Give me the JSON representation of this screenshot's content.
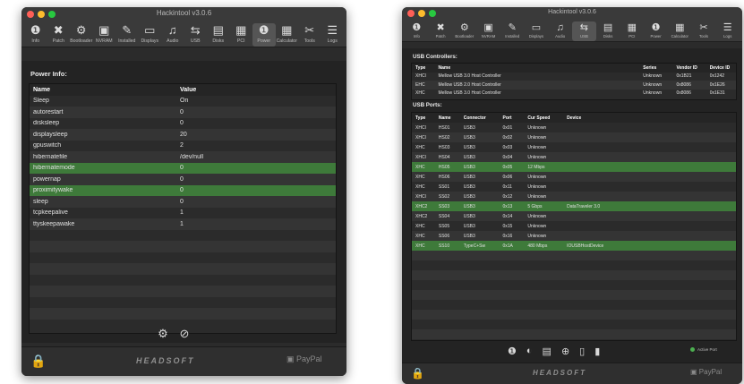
{
  "window1": {
    "title": "Hackintool v3.0.6",
    "toolbar": [
      {
        "icon": "info-icon",
        "glyph": "❶",
        "label": "Info"
      },
      {
        "icon": "patch-icon",
        "glyph": "✖",
        "label": "Patch"
      },
      {
        "icon": "bootloader-icon",
        "glyph": "⚙",
        "label": "Bootloader"
      },
      {
        "icon": "nvram-icon",
        "glyph": "▣",
        "label": "NVRAM"
      },
      {
        "icon": "installed-icon",
        "glyph": "✎",
        "label": "Installed"
      },
      {
        "icon": "displays-icon",
        "glyph": "▭",
        "label": "Displays"
      },
      {
        "icon": "audio-icon",
        "glyph": "♫",
        "label": "Audio"
      },
      {
        "icon": "usb-icon",
        "glyph": "⇆",
        "label": "USB"
      },
      {
        "icon": "disks-icon",
        "glyph": "▤",
        "label": "Disks"
      },
      {
        "icon": "pci-icon",
        "glyph": "▦",
        "label": "PCI"
      },
      {
        "icon": "power-icon",
        "glyph": "❶",
        "label": "Power"
      },
      {
        "icon": "calculator-icon",
        "glyph": "▦",
        "label": "Calculator"
      },
      {
        "icon": "tools-icon",
        "glyph": "✂",
        "label": "Tools"
      },
      {
        "icon": "logs-icon",
        "glyph": "☰",
        "label": "Logs"
      }
    ],
    "active_tab": "Power",
    "section": "Power Info:",
    "columns": [
      "Name",
      "Value"
    ],
    "rows": [
      {
        "name": "Sleep",
        "value": "On",
        "selected": false
      },
      {
        "name": "autorestart",
        "value": "0",
        "selected": false
      },
      {
        "name": "disksleep",
        "value": "0",
        "selected": false
      },
      {
        "name": "displaysleep",
        "value": "20",
        "selected": false
      },
      {
        "name": "gpuswitch",
        "value": "2",
        "selected": false
      },
      {
        "name": "hibernatefile",
        "value": "/dev/null",
        "selected": false
      },
      {
        "name": "hibernatemode",
        "value": "0",
        "selected": true
      },
      {
        "name": "powernap",
        "value": "0",
        "selected": false
      },
      {
        "name": "proximitywake",
        "value": "0",
        "selected": true
      },
      {
        "name": "sleep",
        "value": "0",
        "selected": false
      },
      {
        "name": "tcpkeepalive",
        "value": "1",
        "selected": false
      },
      {
        "name": "ttyskeepawake",
        "value": "1",
        "selected": false
      }
    ],
    "empty_rows": 8,
    "logo": "HEADSOFT",
    "paypal": "PayPal"
  },
  "window2": {
    "title": "Hackintool v3.0.6",
    "toolbar": [
      {
        "icon": "info-icon",
        "glyph": "❶",
        "label": "Info"
      },
      {
        "icon": "patch-icon",
        "glyph": "✖",
        "label": "Patch"
      },
      {
        "icon": "bootloader-icon",
        "glyph": "⚙",
        "label": "Bootloader"
      },
      {
        "icon": "nvram-icon",
        "glyph": "▣",
        "label": "NVRAM"
      },
      {
        "icon": "installed-icon",
        "glyph": "✎",
        "label": "Installed"
      },
      {
        "icon": "displays-icon",
        "glyph": "▭",
        "label": "Displays"
      },
      {
        "icon": "audio-icon",
        "glyph": "♫",
        "label": "Audio"
      },
      {
        "icon": "usb-icon",
        "glyph": "⇆",
        "label": "USB"
      },
      {
        "icon": "disks-icon",
        "glyph": "▤",
        "label": "Disks"
      },
      {
        "icon": "pci-icon",
        "glyph": "▦",
        "label": "PCI"
      },
      {
        "icon": "power-icon",
        "glyph": "❶",
        "label": "Power"
      },
      {
        "icon": "calculator-icon",
        "glyph": "▦",
        "label": "Calculator"
      },
      {
        "icon": "tools-icon",
        "glyph": "✂",
        "label": "Tools"
      },
      {
        "icon": "logs-icon",
        "glyph": "☰",
        "label": "Logs"
      }
    ],
    "active_tab": "USB",
    "controllers_section": "USB Controllers:",
    "controller_columns": [
      "Type",
      "Name",
      "Series",
      "Vendor ID",
      "Device ID"
    ],
    "controllers": [
      {
        "type": "XHCI",
        "name": "Mellow USB 3.0 Host Controller",
        "series": "Unknown",
        "vendor": "0x1B21",
        "device": "0x1242"
      },
      {
        "type": "EHC",
        "name": "Mellow USB 2.0 Host Controller",
        "series": "Unknown",
        "vendor": "0x8086",
        "device": "0x1E26"
      },
      {
        "type": "XHC",
        "name": "Mellow USB 3.0 Host Controller",
        "series": "Unknown",
        "vendor": "0x8086",
        "device": "0x1E31"
      }
    ],
    "ports_section": "USB Ports:",
    "port_columns": [
      "Type",
      "Name",
      "Connector",
      "Port",
      "Cur Speed",
      "Device"
    ],
    "ports": [
      {
        "type": "XHCI",
        "name": "HS01",
        "connector": "USB3",
        "port": "0x01",
        "speed": "Unknown",
        "device": "",
        "selected": false
      },
      {
        "type": "XHCI",
        "name": "HS02",
        "connector": "USB3",
        "port": "0x02",
        "speed": "Unknown",
        "device": "",
        "selected": false
      },
      {
        "type": "XHC",
        "name": "HS03",
        "connector": "USB3",
        "port": "0x03",
        "speed": "Unknown",
        "device": "",
        "selected": false
      },
      {
        "type": "XHCI",
        "name": "HS04",
        "connector": "USB3",
        "port": "0x04",
        "speed": "Unknown",
        "device": "",
        "selected": false
      },
      {
        "type": "XHC",
        "name": "HS05",
        "connector": "USB3",
        "port": "0x05",
        "speed": "12 Mbps",
        "device": "",
        "selected": true
      },
      {
        "type": "XHC",
        "name": "HS06",
        "connector": "USB3",
        "port": "0x06",
        "speed": "Unknown",
        "device": "",
        "selected": false
      },
      {
        "type": "XHC",
        "name": "SS01",
        "connector": "USB3",
        "port": "0x11",
        "speed": "Unknown",
        "device": "",
        "selected": false
      },
      {
        "type": "XHCI",
        "name": "SS02",
        "connector": "USB3",
        "port": "0x12",
        "speed": "Unknown",
        "device": "",
        "selected": false
      },
      {
        "type": "XHC2",
        "name": "SS03",
        "connector": "USB3",
        "port": "0x13",
        "speed": "5 Gbps",
        "device": "DataTraveler 3.0",
        "selected": true
      },
      {
        "type": "XHC2",
        "name": "SS04",
        "connector": "USB3",
        "port": "0x14",
        "speed": "Unknown",
        "device": "",
        "selected": false
      },
      {
        "type": "XHC",
        "name": "SS05",
        "connector": "USB3",
        "port": "0x15",
        "speed": "Unknown",
        "device": "",
        "selected": false
      },
      {
        "type": "XHC",
        "name": "SS06",
        "connector": "USB3",
        "port": "0x16",
        "speed": "Unknown",
        "device": "",
        "selected": false
      },
      {
        "type": "XHC",
        "name": "SS10",
        "connector": "TypeC+Sw",
        "port": "0x1A",
        "speed": "480 Mbps",
        "device": "IOUSBHostDevice",
        "selected": true
      }
    ],
    "empty_rows": 9,
    "legend": "Active Port",
    "logo": "HEADSOFT",
    "paypal": "PayPal"
  }
}
